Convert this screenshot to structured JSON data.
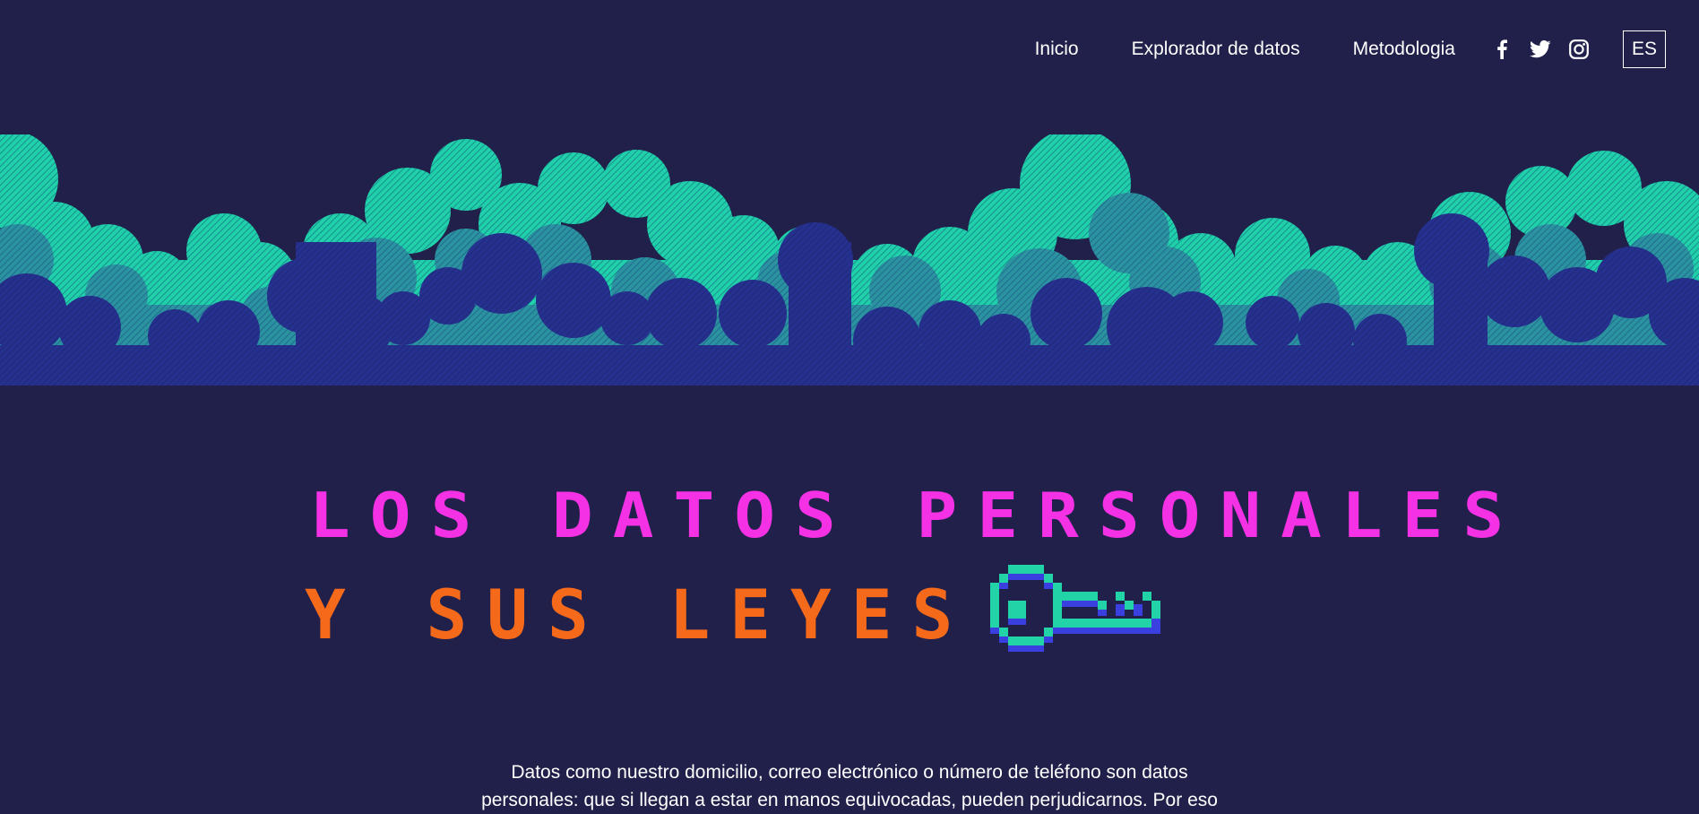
{
  "nav": {
    "links": [
      {
        "label": "Inicio"
      },
      {
        "label": "Explorador de datos"
      },
      {
        "label": "Metodologia"
      }
    ],
    "social": [
      "facebook-icon",
      "twitter-icon",
      "instagram-icon"
    ],
    "language": "ES"
  },
  "hero": {
    "title_line_1": "LOS DATOS PERSONALES",
    "title_line_2": "Y SUS LEYES",
    "icon": "pixel-key-icon"
  },
  "intro": {
    "text": "Datos como nuestro domicilio, correo electrónico o número de teléfono son datos personales: que si llegan a estar en manos equivocadas, pueden perjudicarnos. Por eso"
  },
  "colors": {
    "background": "#21204a",
    "title_pink": "#f531e6",
    "title_orange": "#f5691a",
    "cloud_teal": "#1fd0ab",
    "cloud_mid": "#2a8e9c",
    "cloud_blue": "#252f8c",
    "key_teal": "#22d3a7",
    "key_blue": "#3a3fe0"
  }
}
